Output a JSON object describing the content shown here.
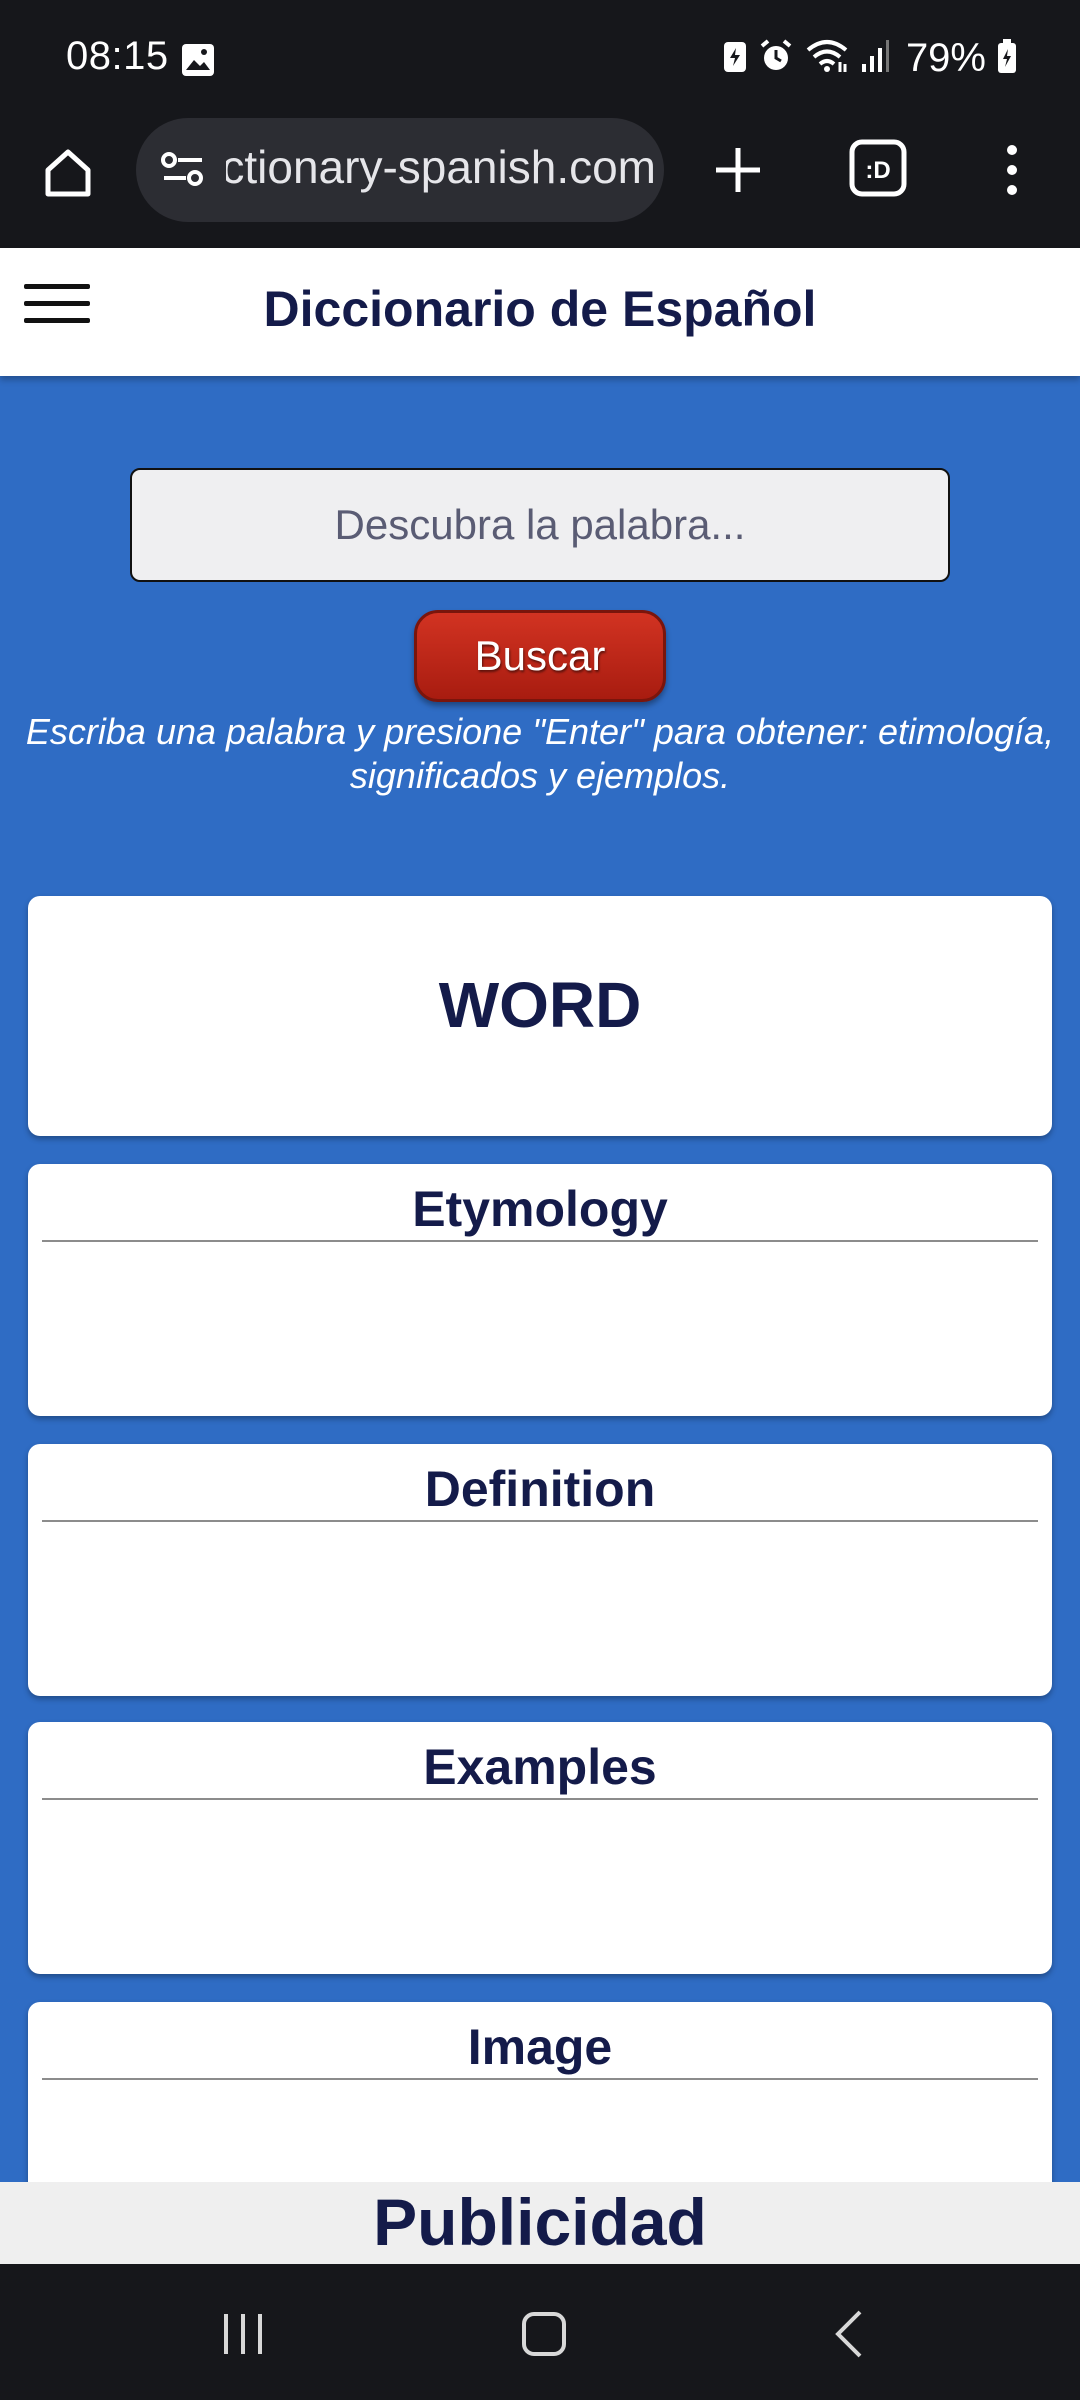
{
  "status_bar": {
    "time": "08:15",
    "battery": "79%",
    "icons": [
      "gallery-icon",
      "battery-saver-icon",
      "alarm-icon",
      "wifi-icon",
      "signal-icon",
      "battery-icon"
    ]
  },
  "browser": {
    "url": "dictionary-spanish.com",
    "tab_count": ":D",
    "icons": [
      "home-icon",
      "tune-icon",
      "plus-icon",
      "tabs-icon",
      "more-vert-icon"
    ]
  },
  "header": {
    "title": "Diccionario de Español"
  },
  "search": {
    "placeholder": "Descubra la palabra...",
    "value": "",
    "button_label": "Buscar",
    "hint": "Escriba una palabra y presione \"Enter\" para obtener: etimología, significados y ejemplos."
  },
  "cards": {
    "word": "WORD",
    "etymology": "Etymology",
    "definition": "Definition",
    "examples": "Examples",
    "image": "Image"
  },
  "ad": {
    "label": "Publicidad"
  },
  "colors": {
    "page_background": "#2f6cc4",
    "title_text": "#141b4a",
    "button": "#c0281a",
    "system_bar": "#16171b"
  }
}
